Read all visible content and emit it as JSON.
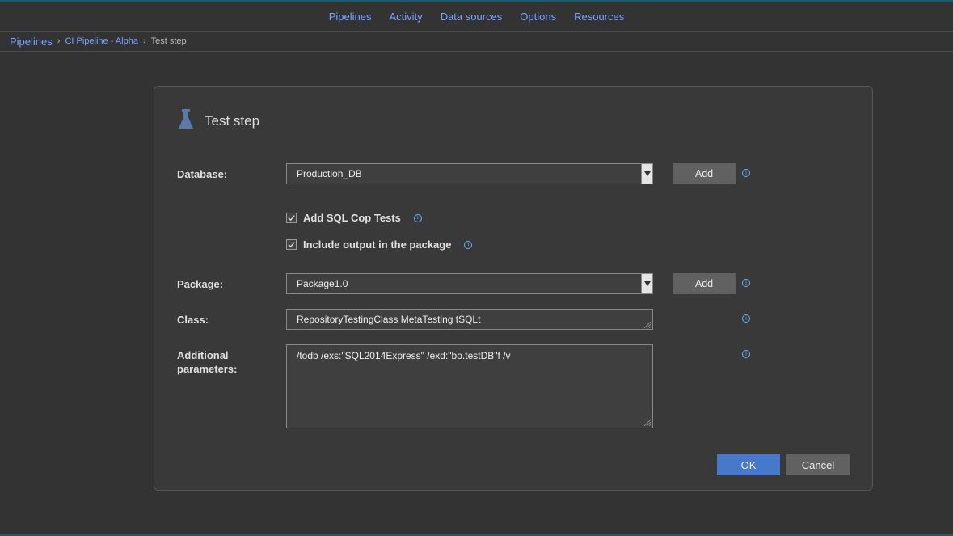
{
  "nav": {
    "items": [
      "Pipelines",
      "Activity",
      "Data sources",
      "Options",
      "Resources"
    ]
  },
  "breadcrumb": {
    "items": [
      "Pipelines",
      "CI Pipeline - Alpha",
      "Test step"
    ]
  },
  "panel": {
    "title": "Test step"
  },
  "form": {
    "database": {
      "label": "Database:",
      "value": "Production_DB",
      "add_label": "Add"
    },
    "sqlCop": {
      "label": "Add SQL Cop Tests",
      "checked": true
    },
    "includeOutput": {
      "label": "Include output in the package",
      "checked": true
    },
    "package": {
      "label": "Package:",
      "value": "Package1.0",
      "add_label": "Add"
    },
    "class": {
      "label": "Class:",
      "value": "RepositoryTestingClass MetaTesting tSQLt"
    },
    "additional": {
      "label": "Additional parameters:",
      "value": "/todb /exs:\"SQL2014Express\" /exd:\"bo.testDB\"f /v"
    }
  },
  "footer": {
    "ok": "OK",
    "cancel": "Cancel"
  }
}
